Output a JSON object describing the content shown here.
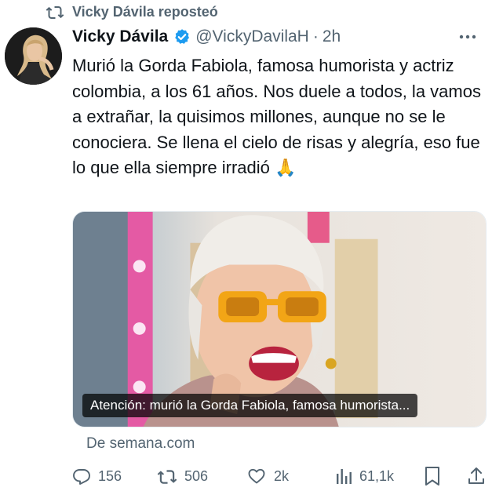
{
  "repost_bar": {
    "text": "Vicky Dávila reposteó",
    "icon": "repost-icon"
  },
  "tweet": {
    "author_name": "Vicky Dávila",
    "handle": "@VickyDavilaH",
    "separator": "·",
    "time": "2h",
    "verified_icon": "verified-badge-icon",
    "more_icon": "more-icon",
    "text": "Murió la Gorda Fabiola, famosa humorista y actriz colombia, a los 61 años. Nos duele a todos, la vamos a extrañar, la quisimos millones, aunque no se le conociera. Se llena el cielo de risas y alegría, eso fue lo que ella siempre irradió 🙏"
  },
  "card": {
    "caption": "Atención: murió la Gorda Fabiola, famosa humorista...",
    "source": "De semana.com"
  },
  "actions": {
    "replies": "156",
    "reposts": "506",
    "likes": "2k",
    "views": "61,1k",
    "icons": [
      "reply-icon",
      "repost-icon",
      "like-icon",
      "views-icon",
      "bookmark-icon",
      "share-icon"
    ]
  },
  "colors": {
    "text_primary": "#0f1419",
    "text_secondary": "#536471",
    "verified_blue": "#1d9bf0"
  }
}
